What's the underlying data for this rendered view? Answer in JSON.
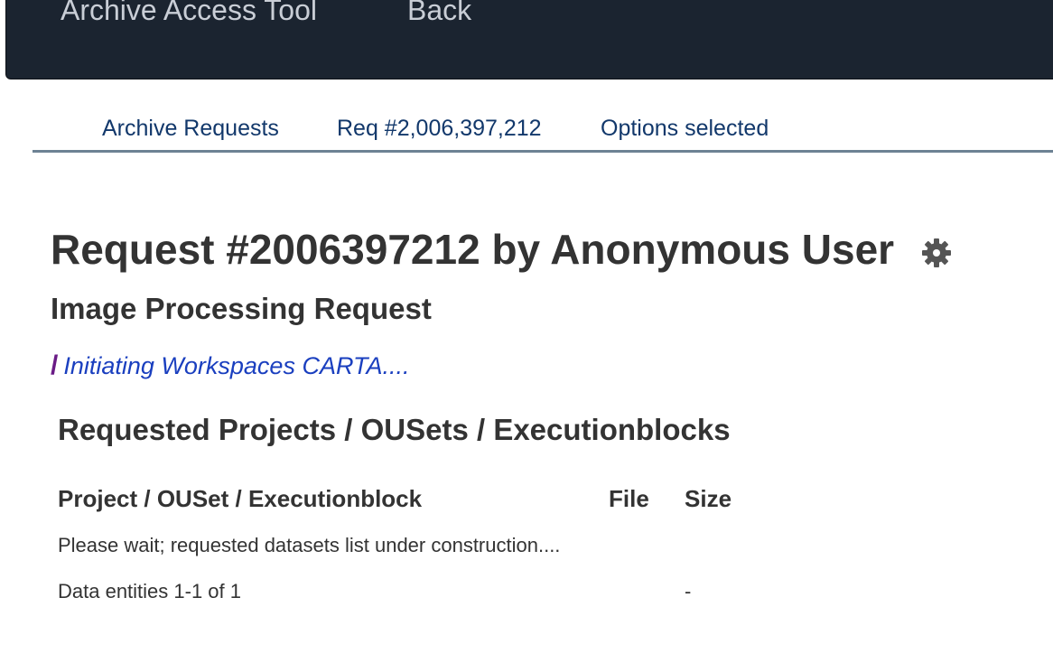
{
  "topbar": {
    "app_title": "Archive Access Tool",
    "back_label": "Back"
  },
  "tabs": [
    {
      "label": "Archive Requests"
    },
    {
      "label": "Req #2,006,397,212"
    },
    {
      "label": "Options selected"
    }
  ],
  "request": {
    "title": "Request #2006397212 by Anonymous User",
    "subtitle": "Image Processing Request",
    "status_spinner": "/",
    "status_message": "Initiating Workspaces CARTA...."
  },
  "datasets": {
    "section_title": "Requested Projects / OUSets / Executionblocks",
    "columns": [
      "Project / OUSet / Executionblock",
      "File",
      "Size"
    ],
    "wait_message": "Please wait; requested datasets list under construction....",
    "summary": "Data entities 1-1 of 1",
    "summary_size": "-"
  },
  "icons": {
    "settings": "gear-icon"
  },
  "colors": {
    "topbar_bg": "#1b2430",
    "tab_link": "#12386b",
    "status_link": "#1a3fbf",
    "spinner": "#6a1b86"
  }
}
